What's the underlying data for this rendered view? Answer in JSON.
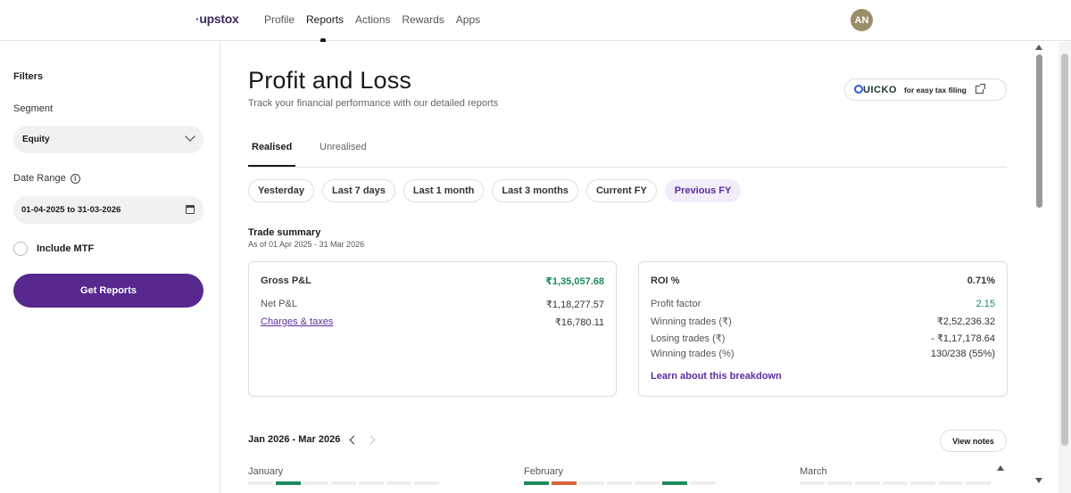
{
  "brand": {
    "logo": "upstox"
  },
  "nav": {
    "items": [
      "Profile",
      "Reports",
      "Actions",
      "Rewards",
      "Apps"
    ],
    "active": "Reports"
  },
  "user": {
    "initials": "AN"
  },
  "sidebar": {
    "filters_title": "Filters",
    "segment_label": "Segment",
    "segment_value": "Equity",
    "date_range_label": "Date Range",
    "date_range_value": "01-04-2025 to 31-03-2026",
    "include_mtf_label": "Include MTF",
    "get_reports_label": "Get Reports"
  },
  "header": {
    "title": "Profit and Loss",
    "subtitle": "Track your financial performance with our detailed reports",
    "quicko_logo": "UICKO",
    "quicko_text": "for easy tax filing"
  },
  "tabs": [
    {
      "label": "Realised",
      "active": true
    },
    {
      "label": "Unrealised",
      "active": false
    }
  ],
  "periods": [
    {
      "label": "Yesterday",
      "active": false
    },
    {
      "label": "Last 7 days",
      "active": false
    },
    {
      "label": "Last 1 month",
      "active": false
    },
    {
      "label": "Last 3 months",
      "active": false
    },
    {
      "label": "Current FY",
      "active": false
    },
    {
      "label": "Previous FY",
      "active": true
    }
  ],
  "trade_summary": {
    "title": "Trade summary",
    "subtitle": "As of 01 Apr 2025 - 31 Mar 2026"
  },
  "pnl_card": {
    "gross_label": "Gross P&L",
    "gross_value": "₹1,35,057.68",
    "net_label": "Net P&L",
    "net_value": "₹1,18,277.57",
    "charges_label": "Charges & taxes",
    "charges_value": "₹16,780.11"
  },
  "roi_card": {
    "roi_label": "ROI %",
    "roi_value": "0.71%",
    "profit_factor_label": "Profit factor",
    "profit_factor_value": "2.15",
    "winning_label": "Winning trades (₹)",
    "winning_value": "₹2,52,236.32",
    "losing_label": "Losing trades (₹)",
    "losing_value": "- ₹1,17,178.64",
    "winning_pct_label": "Winning trades (%)",
    "winning_pct_value": "130/238 (55%)",
    "learn_link": "Learn about this breakdown"
  },
  "calendar": {
    "range": "Jan 2026 - Mar 2026",
    "view_notes": "View notes",
    "months": [
      {
        "name": "January",
        "bars": [
          "n",
          "g",
          "n",
          "n",
          "n",
          "n",
          "n"
        ]
      },
      {
        "name": "February",
        "bars": [
          "g",
          "r",
          "n",
          "n",
          "n",
          "g",
          "n"
        ]
      },
      {
        "name": "March",
        "bars": [
          "n",
          "n",
          "n",
          "n",
          "n",
          "n",
          "n"
        ]
      }
    ]
  },
  "colors": {
    "brand_purple": "#57288e",
    "profit_green": "#1c8a5a",
    "loss_red": "#d9633a"
  }
}
